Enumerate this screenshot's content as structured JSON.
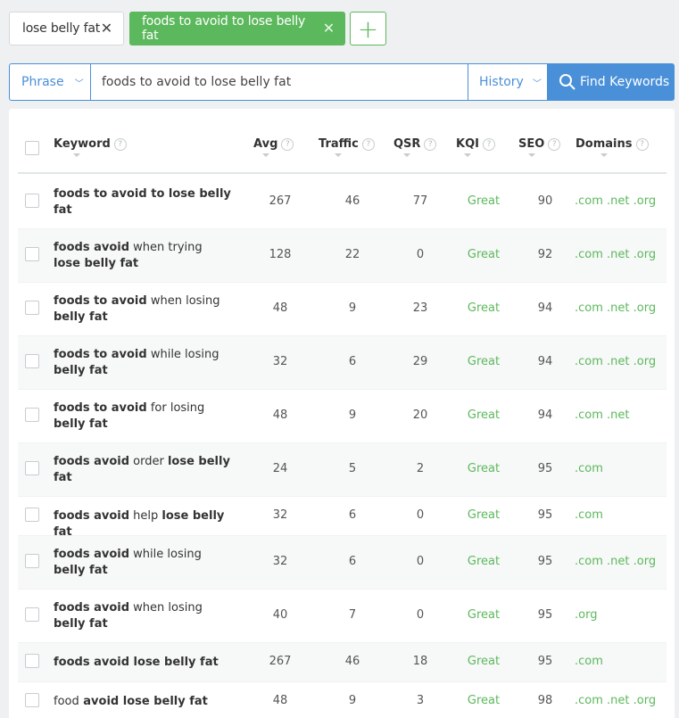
{
  "tabs": [
    {
      "label": "lose belly fat",
      "active": false
    },
    {
      "label": "foods to avoid to lose belly fat",
      "active": true
    }
  ],
  "add_tab_icon": "plus-icon",
  "search": {
    "mode_label": "Phrase",
    "value": "foods to avoid to lose belly fat",
    "history_label": "History",
    "find_label": "Find Keywords"
  },
  "table": {
    "columns": [
      "Keyword",
      "Avg",
      "Traffic",
      "QSR",
      "KQI",
      "SEO",
      "Domains"
    ],
    "rows": [
      {
        "kw": [
          [
            "foods to avoid to lose belly fat",
            true
          ]
        ],
        "avg": "267",
        "traffic": "46",
        "qsr": "77",
        "kqi": "Great",
        "seo": "90",
        "domains": ".com .net .org"
      },
      {
        "kw": [
          [
            "foods avoid",
            true
          ],
          [
            " when trying ",
            false
          ],
          [
            "lose belly fat",
            true
          ]
        ],
        "avg": "128",
        "traffic": "22",
        "qsr": "0",
        "kqi": "Great",
        "seo": "92",
        "domains": ".com .net .org"
      },
      {
        "kw": [
          [
            "foods to avoid",
            true
          ],
          [
            " when losing ",
            false
          ],
          [
            "belly fat",
            true
          ]
        ],
        "avg": "48",
        "traffic": "9",
        "qsr": "23",
        "kqi": "Great",
        "seo": "94",
        "domains": ".com .net .org"
      },
      {
        "kw": [
          [
            "foods to avoid",
            true
          ],
          [
            " while losing ",
            false
          ],
          [
            "belly fat",
            true
          ]
        ],
        "avg": "32",
        "traffic": "6",
        "qsr": "29",
        "kqi": "Great",
        "seo": "94",
        "domains": ".com .net .org"
      },
      {
        "kw": [
          [
            "foods to avoid",
            true
          ],
          [
            " for losing ",
            false
          ],
          [
            "belly fat",
            true
          ]
        ],
        "avg": "48",
        "traffic": "9",
        "qsr": "20",
        "kqi": "Great",
        "seo": "94",
        "domains": ".com .net"
      },
      {
        "kw": [
          [
            "foods avoid",
            true
          ],
          [
            " order ",
            false
          ],
          [
            "lose belly fat",
            true
          ]
        ],
        "avg": "24",
        "traffic": "5",
        "qsr": "2",
        "kqi": "Great",
        "seo": "95",
        "domains": ".com"
      },
      {
        "kw": [
          [
            "foods avoid",
            true
          ],
          [
            " help ",
            false
          ],
          [
            "lose belly fat",
            true
          ]
        ],
        "avg": "32",
        "traffic": "6",
        "qsr": "0",
        "kqi": "Great",
        "seo": "95",
        "domains": ".com"
      },
      {
        "kw": [
          [
            "foods avoid",
            true
          ],
          [
            " while losing ",
            false
          ],
          [
            "belly fat",
            true
          ]
        ],
        "avg": "32",
        "traffic": "6",
        "qsr": "0",
        "kqi": "Great",
        "seo": "95",
        "domains": ".com .net .org"
      },
      {
        "kw": [
          [
            "foods avoid",
            true
          ],
          [
            " when losing ",
            false
          ],
          [
            "belly fat",
            true
          ]
        ],
        "avg": "40",
        "traffic": "7",
        "qsr": "0",
        "kqi": "Great",
        "seo": "95",
        "domains": ".org"
      },
      {
        "kw": [
          [
            "foods avoid lose belly fat",
            true
          ]
        ],
        "avg": "267",
        "traffic": "46",
        "qsr": "18",
        "kqi": "Great",
        "seo": "95",
        "domains": ".com"
      },
      {
        "kw": [
          [
            "food",
            false
          ],
          [
            " avoid lose belly fat",
            true
          ]
        ],
        "avg": "48",
        "traffic": "9",
        "qsr": "3",
        "kqi": "Great",
        "seo": "98",
        "domains": ".com .net .org"
      }
    ]
  },
  "colors": {
    "accent_green": "#5cb85c",
    "accent_blue": "#4a90d9"
  }
}
